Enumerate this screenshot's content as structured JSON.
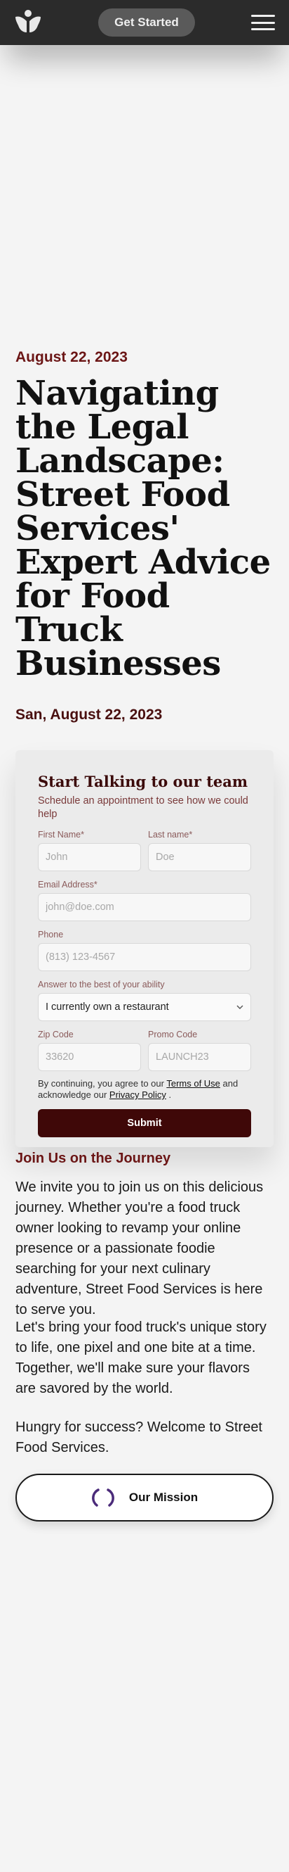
{
  "header": {
    "cta_label": "Get Started"
  },
  "article": {
    "date_top": "August 22, 2023",
    "title": "Navigating the Legal Landscape: Street Food Services' Expert Advice for Food Truck Businesses",
    "date_bottom": "San, August 22, 2023"
  },
  "form": {
    "title": "Start Talking to our team",
    "subtitle": "Schedule an appointment to see how we could help",
    "first_name": {
      "label": "First Name*",
      "placeholder": "John"
    },
    "last_name": {
      "label": "Last name*",
      "placeholder": "Doe"
    },
    "email": {
      "label": "Email Address*",
      "placeholder": "john@doe.com"
    },
    "phone": {
      "label": "Phone",
      "placeholder": "(813) 123-4567"
    },
    "ability": {
      "label": "Answer to the best of your ability",
      "value": "I currently own a restaurant"
    },
    "zip": {
      "label": "Zip Code",
      "placeholder": "33620"
    },
    "promo": {
      "label": "Promo Code",
      "placeholder": "LAUNCH23"
    },
    "consent_prefix": "By continuing, you agree to our",
    "terms_link": "Terms of Use",
    "consent_middle": "and acknowledge our",
    "privacy_link": "Privacy Policy",
    "consent_suffix": ".",
    "submit_label": "Submit"
  },
  "journey": {
    "heading": "Join Us on the Journey",
    "para1": "We invite you to join us on this delicious journey. Whether you're a food truck owner looking to revamp your online presence or a passionate foodie searching for your next culinary adventure, Street Food Services is here to serve you.",
    "para2": "Let's bring your food truck's unique story to life, one pixel and one bite at a time. Together, we'll make sure your flavors are savored by the world.",
    "para3": "Hungry for success? Welcome to Street Food Services."
  },
  "mission": {
    "label": "Our Mission",
    "icon": "loading-spinner-icon"
  },
  "colors": {
    "accent": "#6b1515",
    "submit": "#3f0808",
    "header_bg": "#2b2b2b"
  }
}
